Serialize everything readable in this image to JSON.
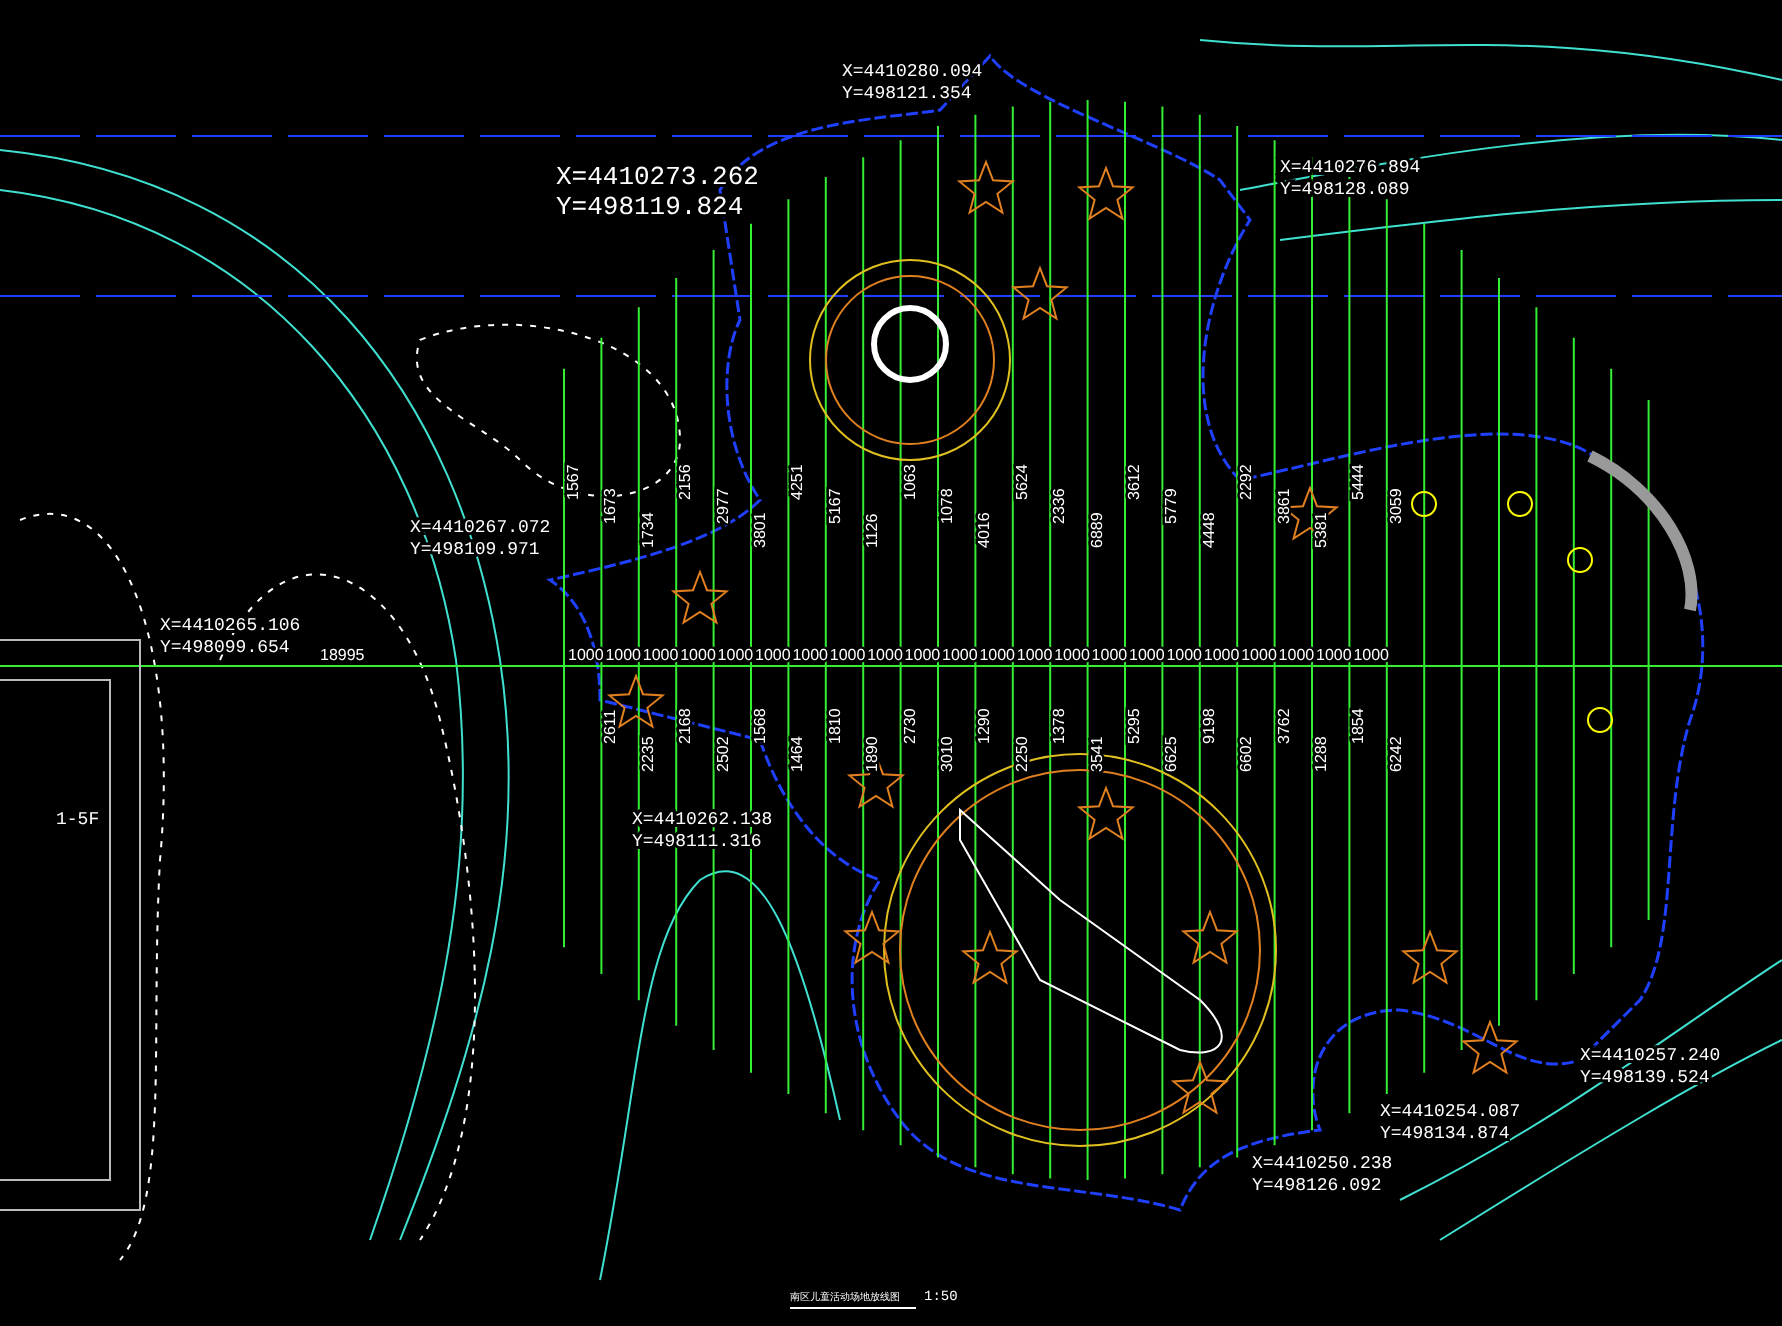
{
  "coordinates": [
    {
      "x": "X=4410280.094",
      "y": "Y=498121.354"
    },
    {
      "x": "X=4410273.262",
      "y": "Y=498119.824"
    },
    {
      "x": "X=4410276.894",
      "y": "Y=498128.089"
    },
    {
      "x": "X=4410267.072",
      "y": "Y=498109.971"
    },
    {
      "x": "X=4410265.106",
      "y": "Y=498099.654"
    },
    {
      "x": "X=4410262.138",
      "y": "Y=498111.316"
    },
    {
      "x": "X=4410257.240",
      "y": "Y=498139.524"
    },
    {
      "x": "X=4410254.087",
      "y": "Y=498134.874"
    },
    {
      "x": "X=4410250.238",
      "y": "Y=498126.092"
    }
  ],
  "baseline_length": "18995",
  "baseline_dims": [
    "1000",
    "1000",
    "1000",
    "1000",
    "1000",
    "1000",
    "1000",
    "1000",
    "1000",
    "1000",
    "1000",
    "1000",
    "1000",
    "1000",
    "1000",
    "1000",
    "1000",
    "1000",
    "1000",
    "1000",
    "1000",
    "1000"
  ],
  "upper_dims": [
    "1567",
    "1673",
    "1734",
    "2156",
    "2977",
    "3801",
    "4251",
    "5167",
    "1126",
    "1063",
    "1078",
    "4016",
    "5624",
    "2336",
    "6889",
    "3612",
    "5779",
    "4448",
    "2292",
    "3861",
    "5381",
    "5444",
    "3059"
  ],
  "lower_dims": [
    "2611",
    "2235",
    "2168",
    "2502",
    "1568",
    "1464",
    "1810",
    "1890",
    "2730",
    "3010",
    "1290",
    "2250",
    "1378",
    "3541",
    "5295",
    "6625",
    "9198",
    "6602",
    "3762",
    "1288",
    "1854",
    "6242"
  ],
  "room_label": "1-5F",
  "drawing_title": "南区儿童活动场地放线图",
  "scale": "1:50"
}
